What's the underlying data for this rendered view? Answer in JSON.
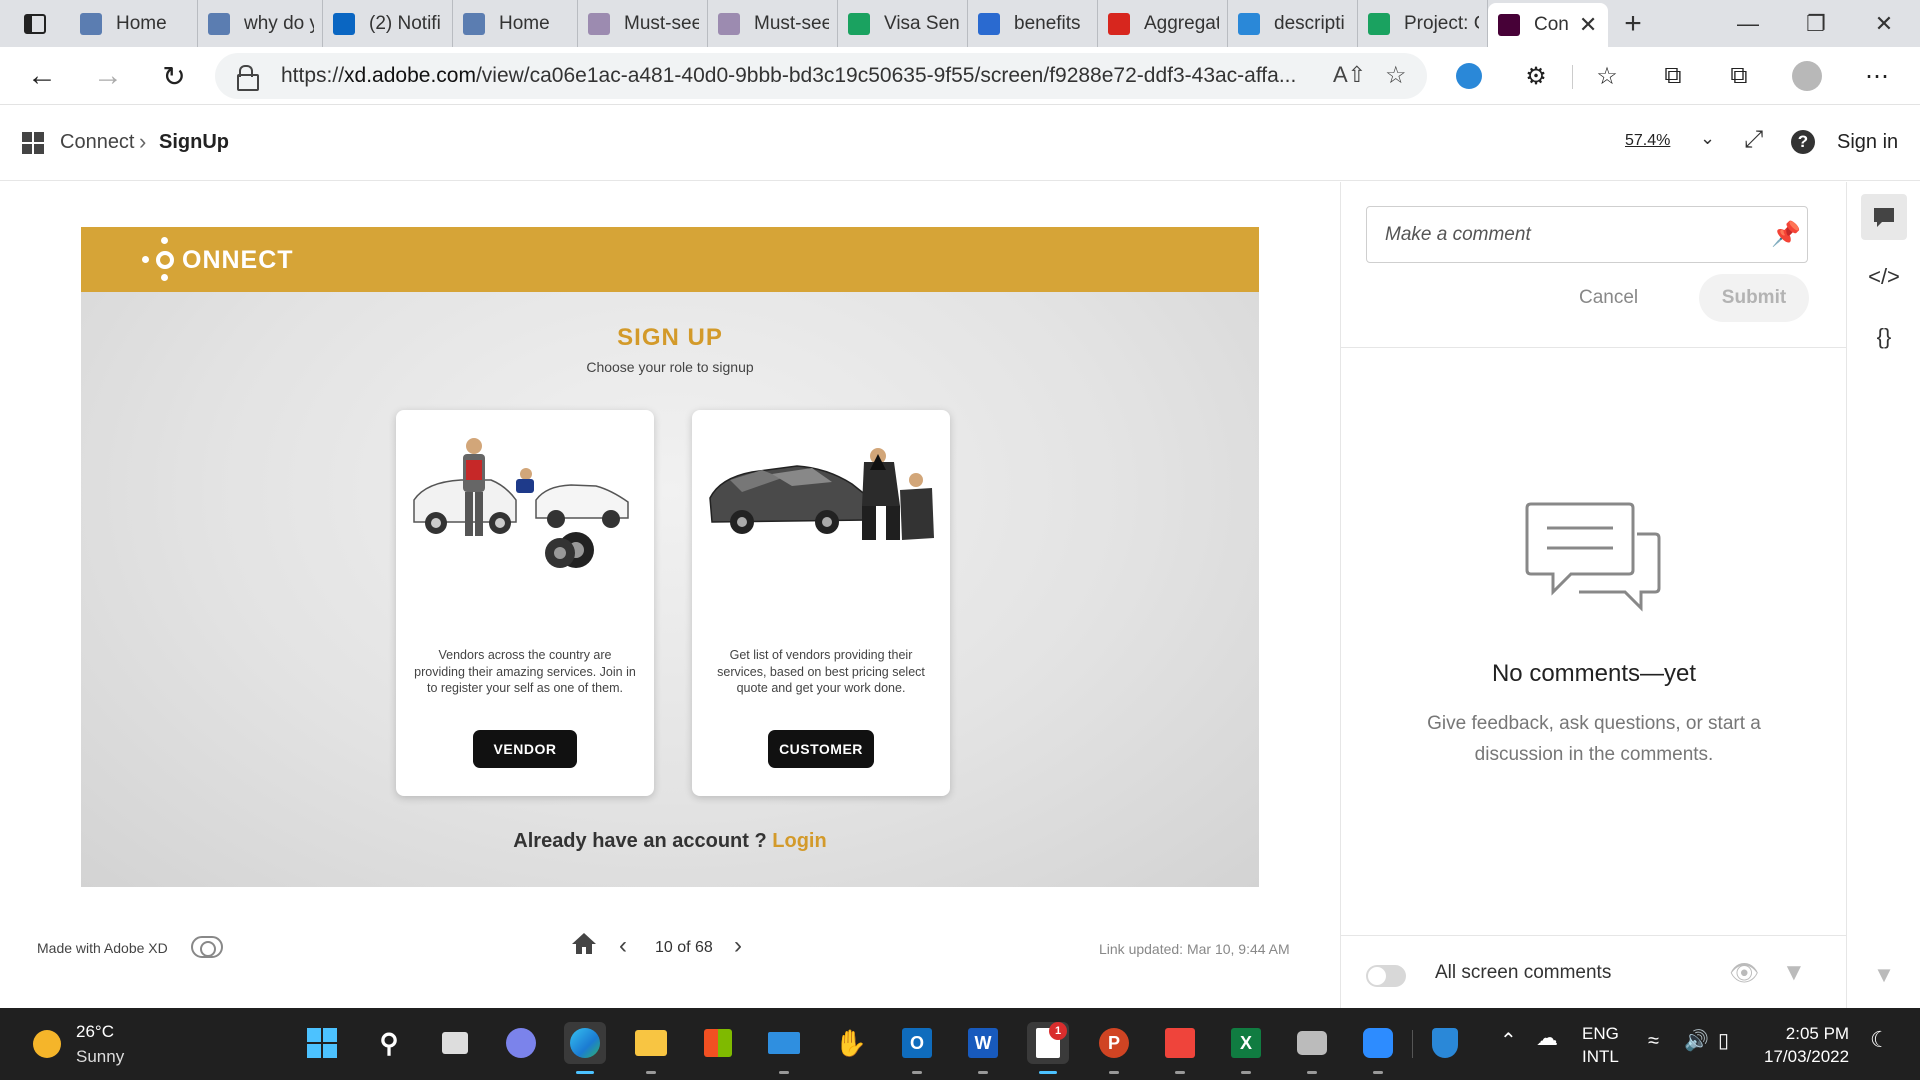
{
  "browser": {
    "tabs": [
      {
        "label": "Home",
        "icon": "app-icon",
        "color": "#5b7db1"
      },
      {
        "label": "why do y",
        "icon": "search-icon",
        "color": "#5b7db1"
      },
      {
        "label": "(2) Notifi",
        "icon": "linkedin-icon",
        "color": "#0a66c2"
      },
      {
        "label": "Home",
        "icon": "app-icon",
        "color": "#5b7db1"
      },
      {
        "label": "Must-see",
        "icon": "page-icon",
        "color": "#9c8bb0"
      },
      {
        "label": "Must-see",
        "icon": "page-icon",
        "color": "#9c8bb0"
      },
      {
        "label": "Visa Seni",
        "icon": "dollar-icon",
        "color": "#1aa260"
      },
      {
        "label": "benefits",
        "icon": "search-icon",
        "color": "#2a6ad0"
      },
      {
        "label": "Aggregat",
        "icon": "v-logo-icon",
        "color": "#d7261e"
      },
      {
        "label": "descripti",
        "icon": "bing-icon",
        "color": "#2a88d8"
      },
      {
        "label": "Project: C",
        "icon": "sheets-icon",
        "color": "#1aa260"
      },
      {
        "label": "Con",
        "icon": "xd-icon",
        "color": "#470137",
        "active": true
      }
    ],
    "address": {
      "url_prefix": "https://",
      "url_domain": "xd.adobe.com",
      "url_path": "/view/ca06e1ac-a481-40d0-9bbb-bd3c19c50635-9f55/screen/f9288e72-ddf3-43ac-affa..."
    }
  },
  "xd": {
    "breadcrumb": {
      "root": "Connect",
      "current": "SignUp"
    },
    "zoom": "57.4%",
    "sign_in": "Sign in",
    "prototype": {
      "brand": "ONNECT",
      "title": "SIGN UP",
      "subtitle": "Choose your role to signup",
      "vendor_card": {
        "description": "Vendors across the country are providing their amazing services. Join in to register your self as one of them.",
        "button": "VENDOR"
      },
      "customer_card": {
        "description": "Get list of vendors providing their services, based on best pricing select quote and get your work done.",
        "button": "CUSTOMER"
      },
      "already": "Already have an account ?",
      "login": "Login"
    },
    "footer": {
      "made_with": "Made with Adobe XD",
      "page": "10 of 68",
      "updated": "Link updated: Mar 10, 9:44 AM"
    },
    "comments": {
      "placeholder": "Make a comment",
      "cancel": "Cancel",
      "submit": "Submit",
      "empty_title": "No comments—yet",
      "empty_sub": "Give feedback, ask questions, or start a discussion in the comments.",
      "all_screen": "All screen comments"
    }
  },
  "taskbar": {
    "temp": "26°C",
    "condition": "Sunny",
    "lang1": "ENG",
    "lang2": "INTL",
    "time": "2:05 PM",
    "date": "17/03/2022",
    "badge": "1"
  }
}
